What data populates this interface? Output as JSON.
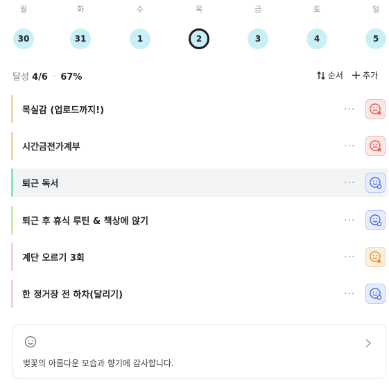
{
  "week": [
    {
      "label": "월",
      "date": "30",
      "selected": false
    },
    {
      "label": "화",
      "date": "31",
      "selected": false
    },
    {
      "label": "수",
      "date": "1",
      "selected": false
    },
    {
      "label": "목",
      "date": "2",
      "selected": true
    },
    {
      "label": "금",
      "date": "3",
      "selected": false
    },
    {
      "label": "토",
      "date": "4",
      "selected": false
    },
    {
      "label": "일",
      "date": "5",
      "selected": false
    }
  ],
  "summary": {
    "prefix": "달성",
    "progress": "4/6",
    "percent": "67%"
  },
  "actions": {
    "sort_label": "순서",
    "add_label": "추가"
  },
  "tasks": [
    {
      "title": "목실감 (업로드까지!)",
      "bar_color": "#f6d2a8",
      "mood": "sad-x",
      "mood_color": "#e3574d",
      "mood_bg": "#fde8e6",
      "mood_border": "#f3b9b4",
      "highlight": false
    },
    {
      "title": "시간금전가계부",
      "bar_color": "#f6d2a8",
      "mood": "sad-x",
      "mood_color": "#e3574d",
      "mood_bg": "#fde8e6",
      "mood_border": "#f3b9b4",
      "highlight": false
    },
    {
      "title": "퇴근 독서",
      "bar_color": "#8fe0c8",
      "mood": "smile-check",
      "mood_color": "#4b6be0",
      "mood_bg": "#e7ecfd",
      "mood_border": "#b8c6f5",
      "highlight": true
    },
    {
      "title": "퇴근 후 휴식 루틴 & 책상에 앉기",
      "bar_color": "#c8ec9c",
      "mood": "smile-check",
      "mood_color": "#4b6be0",
      "mood_bg": "#e7ecfd",
      "mood_border": "#b8c6f5",
      "highlight": false
    },
    {
      "title": "계단 오르기 3회",
      "bar_color": "#f7cde0",
      "mood": "neutral-warn",
      "mood_color": "#ee8a2e",
      "mood_bg": "#fdeedd",
      "mood_border": "#f7cfa6",
      "highlight": false
    },
    {
      "title": "한 정거장 전 하차(달리기)",
      "bar_color": "#f7cde0",
      "mood": "smile-check",
      "mood_color": "#4b6be0",
      "mood_bg": "#e7ecfd",
      "mood_border": "#b8c6f5",
      "highlight": false
    }
  ],
  "more_symbol": "···",
  "note": {
    "icon": "smile-icon",
    "text": "벚꽃의 아름다운 모습과 향기에 감사합니다."
  }
}
